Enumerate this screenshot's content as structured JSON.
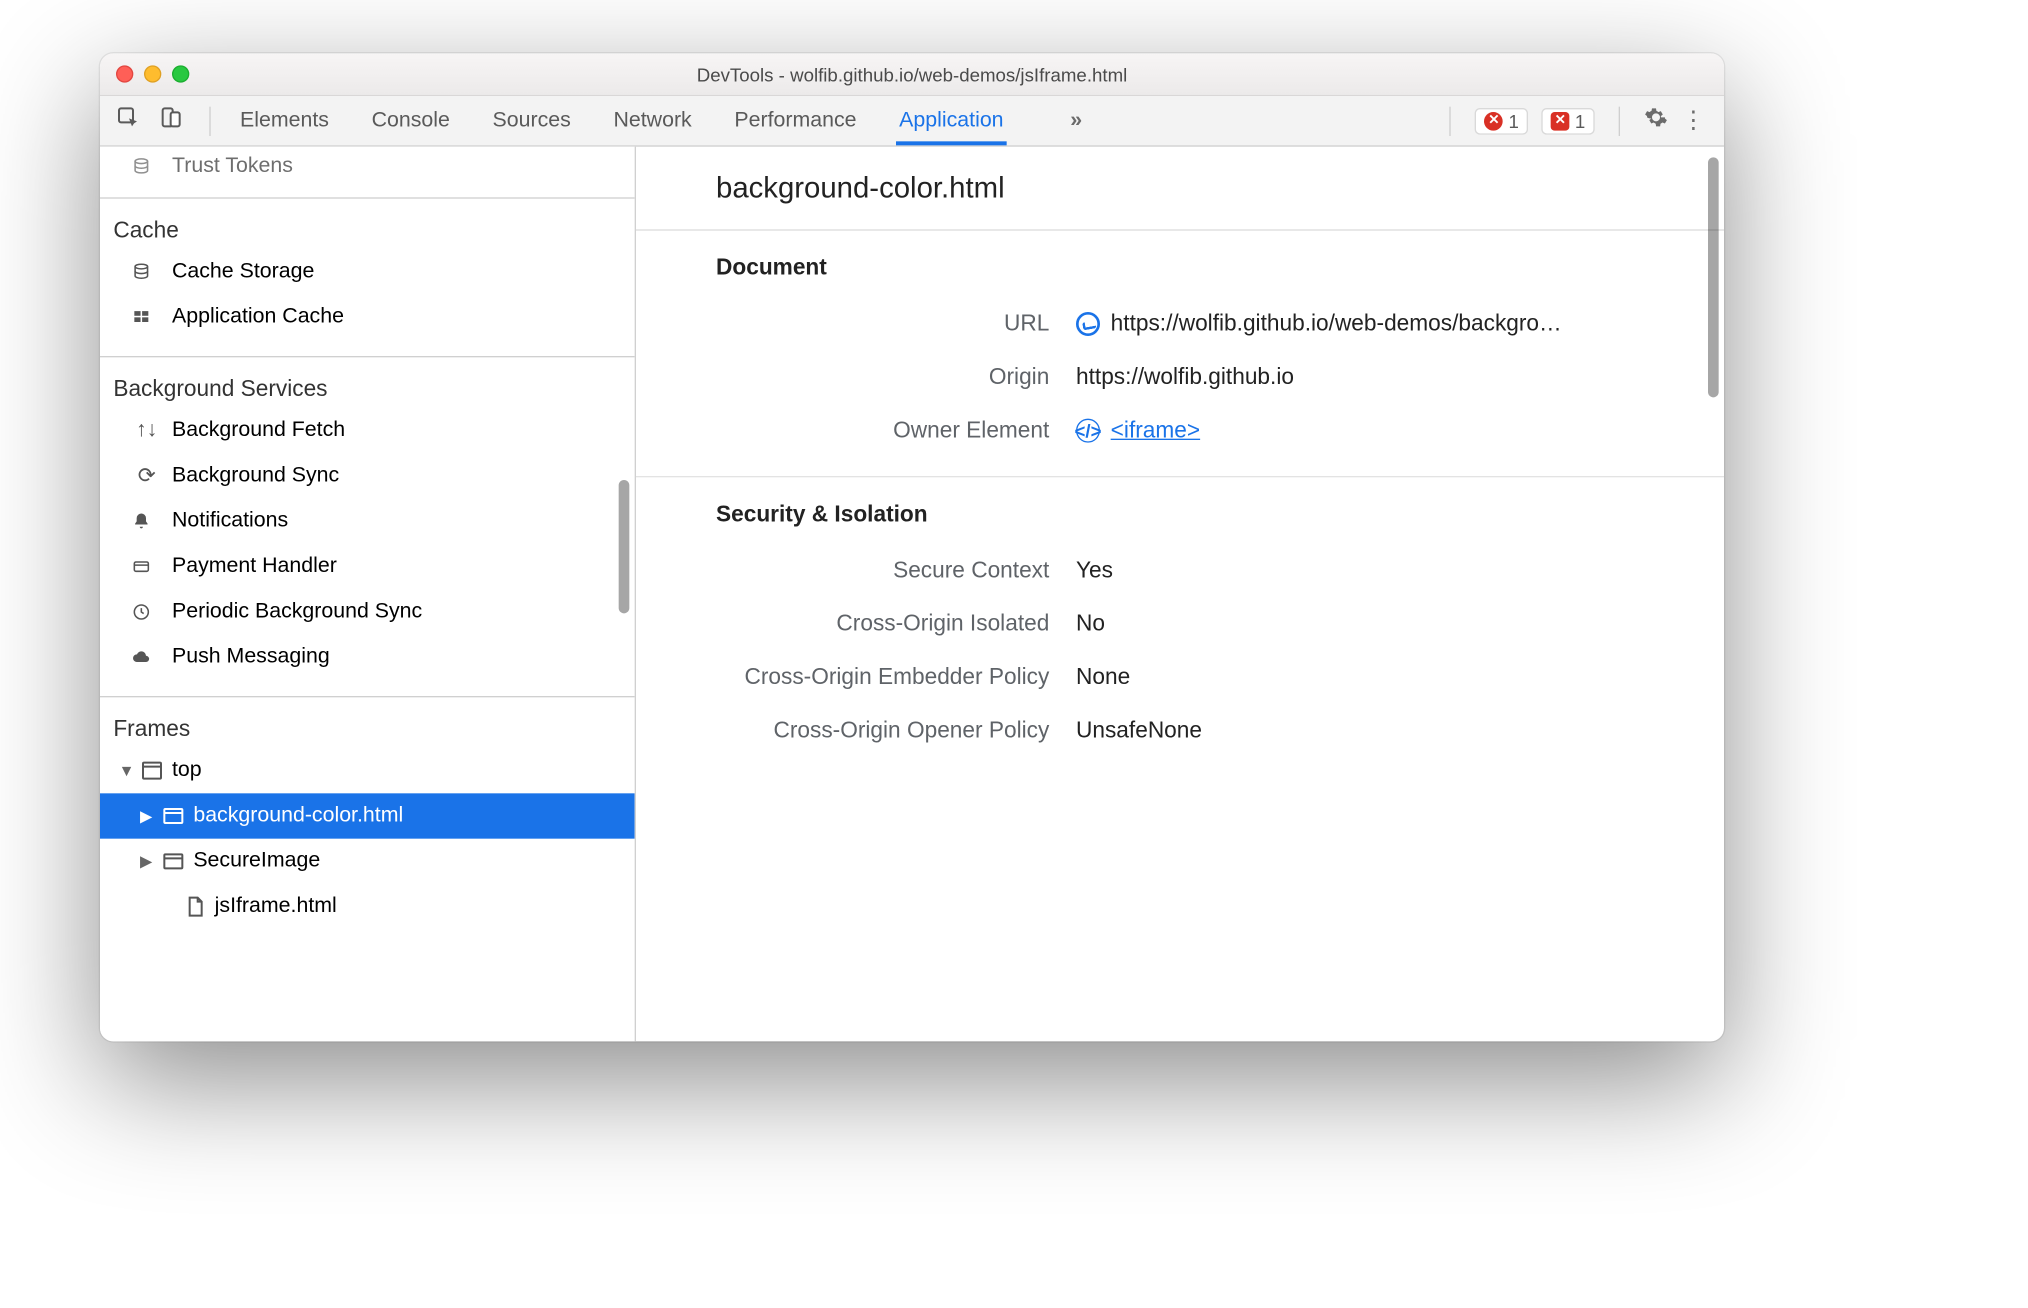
{
  "window": {
    "title": "DevTools - wolfib.github.io/web-demos/jsIframe.html"
  },
  "toolbar": {
    "tabs": [
      "Elements",
      "Console",
      "Sources",
      "Network",
      "Performance",
      "Application"
    ],
    "activeTab": "Application",
    "errorCount": "1",
    "issueCount": "1"
  },
  "sidebar": {
    "trustTokens": "Trust Tokens",
    "sections": {
      "cache": {
        "title": "Cache",
        "items": [
          "Cache Storage",
          "Application Cache"
        ]
      },
      "bgServices": {
        "title": "Background Services",
        "items": [
          "Background Fetch",
          "Background Sync",
          "Notifications",
          "Payment Handler",
          "Periodic Background Sync",
          "Push Messaging"
        ]
      },
      "frames": {
        "title": "Frames",
        "tree": {
          "top": "top",
          "bgColor": "background-color.html",
          "secureImage": "SecureImage",
          "jsIframe": "jsIframe.html"
        }
      }
    }
  },
  "detail": {
    "title": "background-color.html",
    "document": {
      "heading": "Document",
      "urlLabel": "URL",
      "urlValue": "https://wolfib.github.io/web-demos/backgro…",
      "originLabel": "Origin",
      "originValue": "https://wolfib.github.io",
      "ownerLabel": "Owner Element",
      "ownerValue": " <iframe>"
    },
    "security": {
      "heading": "Security & Isolation",
      "rows": [
        {
          "k": "Secure Context",
          "v": "Yes"
        },
        {
          "k": "Cross-Origin Isolated",
          "v": "No"
        },
        {
          "k": "Cross-Origin Embedder Policy",
          "v": "None"
        },
        {
          "k": "Cross-Origin Opener Policy",
          "v": "UnsafeNone"
        }
      ]
    }
  }
}
